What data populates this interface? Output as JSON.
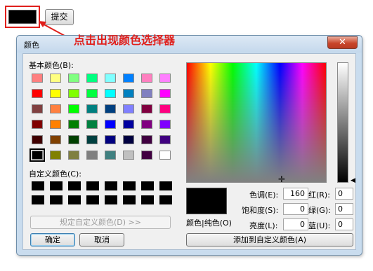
{
  "page": {
    "submit_label": "提交",
    "annotation": "点击出现颜色选择器"
  },
  "dialog": {
    "title": "颜色",
    "close_label": "✕",
    "basic_colors_label": "基本颜色(B):",
    "custom_colors_label": "自定义颜色(C):",
    "define_custom_label": "规定自定义颜色(D) >>",
    "ok_label": "确定",
    "cancel_label": "取消",
    "color_solid_label": "颜色|纯色(O)",
    "hue_label": "色调(E):",
    "hue_value": "160",
    "sat_label": "饱和度(S):",
    "sat_value": "0",
    "lum_label": "亮度(L):",
    "lum_value": "0",
    "red_label": "红(R):",
    "red_value": "0",
    "green_label": "绿(G):",
    "green_value": "0",
    "blue_label": "蓝(U):",
    "blue_value": "0",
    "add_custom_label": "添加到自定义颜色(A)"
  },
  "basic_colors": [
    [
      "#ff8080",
      "#ffff80",
      "#80ff80",
      "#00ff80",
      "#80ffff",
      "#0080ff",
      "#ff80c0",
      "#ff80ff"
    ],
    [
      "#ff0000",
      "#ffff00",
      "#80ff00",
      "#00ff40",
      "#00ffff",
      "#0080c0",
      "#8080c0",
      "#ff00ff"
    ],
    [
      "#804040",
      "#ff8040",
      "#00ff00",
      "#008080",
      "#004080",
      "#8080ff",
      "#800040",
      "#ff0080"
    ],
    [
      "#800000",
      "#ff8000",
      "#008000",
      "#008040",
      "#0000ff",
      "#0000a0",
      "#800080",
      "#8000ff"
    ],
    [
      "#400000",
      "#804000",
      "#004000",
      "#004040",
      "#000080",
      "#000040",
      "#400040",
      "#400080"
    ],
    [
      "#000000",
      "#808000",
      "#808040",
      "#808080",
      "#408080",
      "#c0c0c0",
      "#400040",
      "#ffffff"
    ]
  ],
  "selected_basic_color": "#000000",
  "custom_colors": [
    "#000000",
    "#000000",
    "#000000",
    "#000000",
    "#000000",
    "#000000",
    "#000000",
    "#000000",
    "#000000",
    "#000000",
    "#000000",
    "#000000",
    "#000000",
    "#000000",
    "#000000",
    "#000000"
  ],
  "current_color": "#000000",
  "accent_color": "#e0201c"
}
